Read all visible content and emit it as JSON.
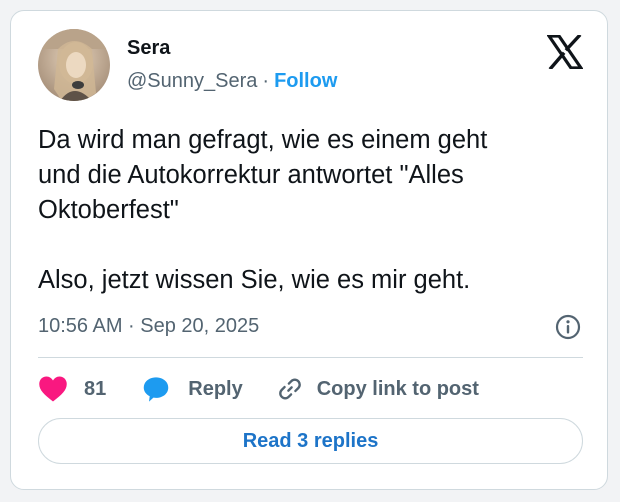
{
  "author": {
    "name": "Sera",
    "handle": "@Sunny_Sera",
    "separator": "·",
    "follow_label": "Follow"
  },
  "tweet": {
    "text": "Da wird man gefragt, wie es einem geht\nund die Autokorrektur antwortet \"Alles\nOktoberfest\"\n\nAlso, jetzt wissen Sie, wie es mir geht.",
    "timestamp": "10:56 AM · Sep 20, 2025"
  },
  "actions": {
    "like_count": "81",
    "reply_label": "Reply",
    "copy_link_label": "Copy link to post"
  },
  "read_replies_label": "Read 3 replies",
  "icons": {
    "logo": "x-logo-icon",
    "info": "info-icon",
    "like": "heart-icon",
    "reply": "speech-bubble-icon",
    "copy_link": "link-icon"
  },
  "colors": {
    "accent": "#1d9bf0",
    "heart": "#f91880",
    "reply_bubble": "#1d9bf0",
    "read_replies_text": "#1d74c8",
    "text_primary": "#0f1419",
    "text_secondary": "#536471"
  }
}
